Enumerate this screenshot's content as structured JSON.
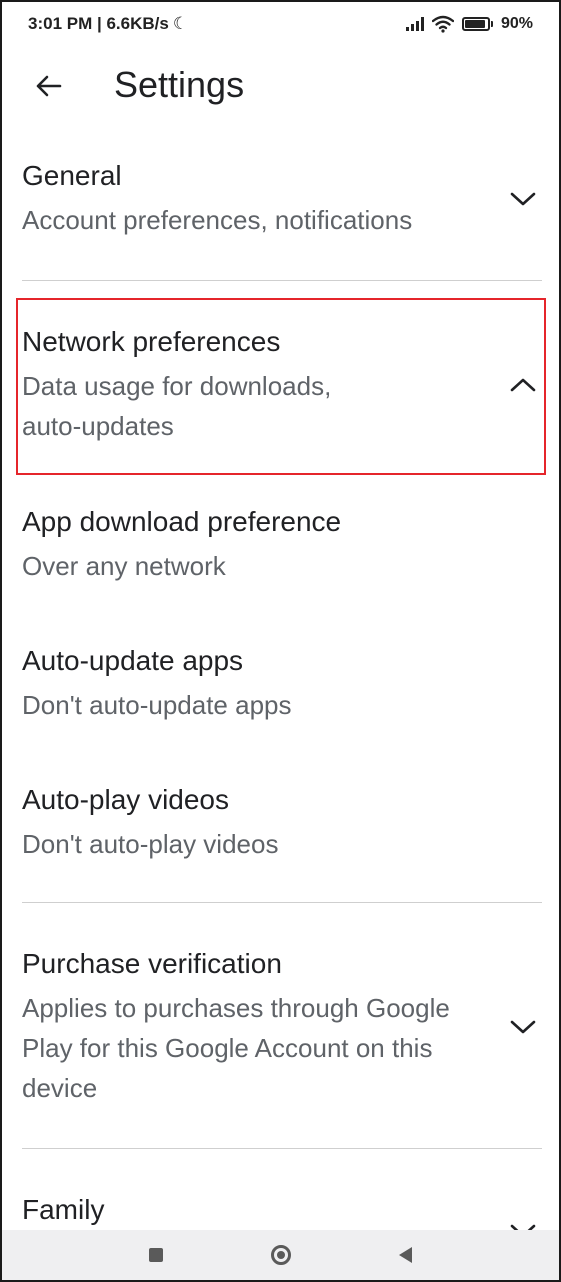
{
  "statusbar": {
    "time_speed": "3:01 PM | 6.6KB/s",
    "moon_glyph": "☾",
    "battery": "90%"
  },
  "header": {
    "title": "Settings",
    "back_icon": "arrow-back-icon"
  },
  "sections": {
    "general": {
      "title": "General",
      "subtitle": "Account preferences, notifications",
      "expanded": false
    },
    "network": {
      "title": "Network preferences",
      "subtitle_line1": "Data usage for downloads,",
      "subtitle_line2": "auto-updates",
      "expanded": true,
      "highlight_color": "#e5252b"
    },
    "network_items": [
      {
        "title": "App download preference",
        "value": "Over any network"
      },
      {
        "title": "Auto-update apps",
        "value": "Don't auto-update apps"
      },
      {
        "title": "Auto-play videos",
        "value": "Don't auto-play videos"
      }
    ],
    "purchase": {
      "title": "Purchase verification",
      "subtitle_line1": "Applies to purchases through Google",
      "subtitle_line2": "Play for this Google Account on this",
      "subtitle_line3": "device",
      "expanded": false
    },
    "family": {
      "title": "Family",
      "expanded": false
    }
  },
  "navbar": {
    "icons": [
      "recents-square-icon",
      "home-circle-icon",
      "back-triangle-icon"
    ]
  }
}
